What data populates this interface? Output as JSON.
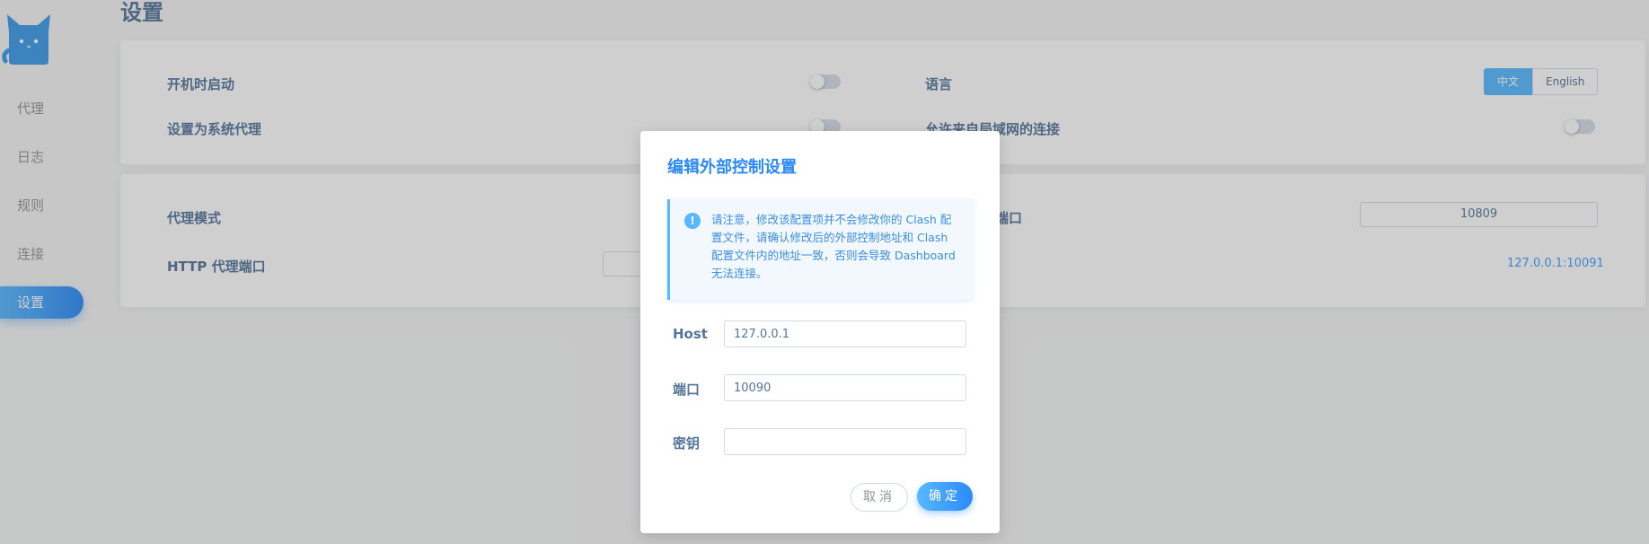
{
  "sidebar": {
    "logo": "cat-logo-icon",
    "items": [
      {
        "label": "代理"
      },
      {
        "label": "日志"
      },
      {
        "label": "规则"
      },
      {
        "label": "连接"
      },
      {
        "label": "设置",
        "active": true
      }
    ]
  },
  "page": {
    "title": "设置"
  },
  "settings1": {
    "startup_label": "开机时启动",
    "startup_on": false,
    "language_label": "语言",
    "lang_zh": "中文",
    "lang_en": "English",
    "lang_selected": "中文",
    "system_proxy_label": "设置为系统代理",
    "system_proxy_on": false,
    "allow_lan_label": "允许来自局域网的连接",
    "allow_lan_on": false
  },
  "settings2": {
    "proxy_mode_label": "代理模式",
    "http_port_label": "HTTP 代理端口",
    "socks_port_label_partial": "端口",
    "socks_port_value": "10809",
    "external_controller_value": "127.0.0.1:10091"
  },
  "dialog": {
    "title": "编辑外部控制设置",
    "alert_text": "请注意，修改该配置项并不会修改你的 Clash 配置文件，请确认修改后的外部控制地址和 Clash 配置文件内的地址一致，否则会导致 Dashboard 无法连接。",
    "host_label": "Host",
    "host_value": "127.0.0.1",
    "port_label": "端口",
    "port_value": "10090",
    "secret_label": "密钥",
    "secret_value": "",
    "cancel_label": "取消",
    "ok_label": "确定"
  },
  "colors": {
    "accent": "#2c8af8",
    "accent_light": "#57b8ff",
    "text": "#54759a",
    "overlay": "rgba(64,64,64,0.25)"
  }
}
